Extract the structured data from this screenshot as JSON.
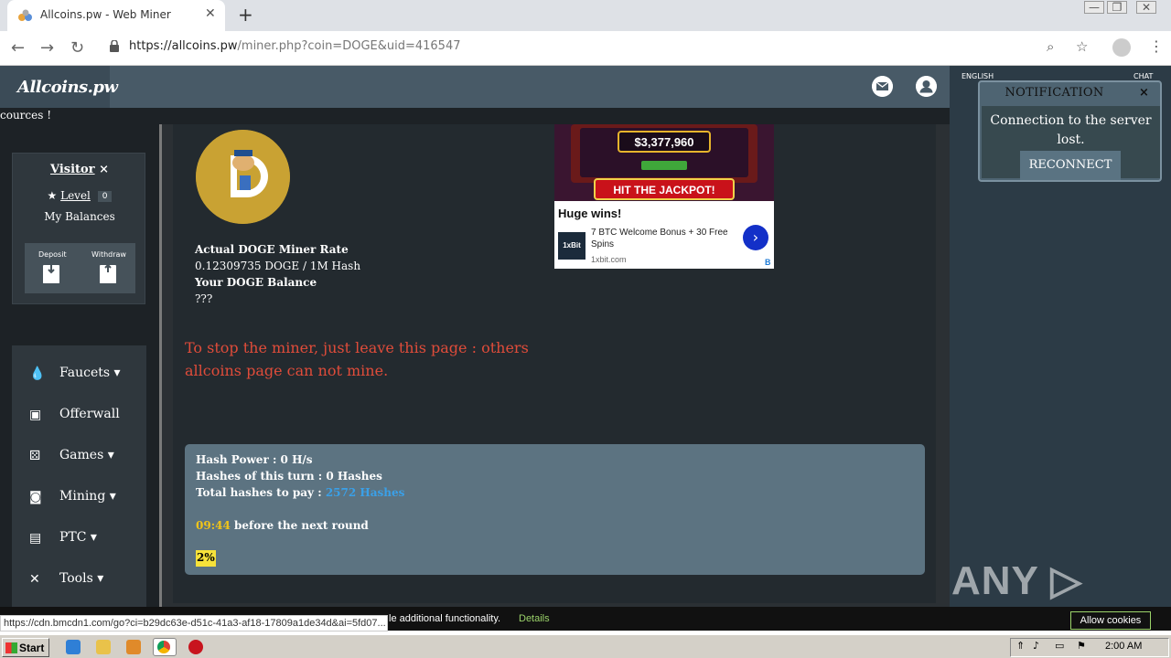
{
  "browser": {
    "tab_title": "Allcoins.pw - Web Miner",
    "tab_close": "✕",
    "new_tab": "+",
    "url_host": "https://allcoins.pw",
    "url_path": "/miner.php?coin=DOGE&uid=416547",
    "back": "←",
    "forward": "→",
    "reload": "↻",
    "zoom_icon": "⌕",
    "star_icon": "☆",
    "menu_icon": "⋮",
    "window_controls": [
      "—",
      "❐",
      "✕"
    ]
  },
  "site": {
    "logo": "Allcoins.pw",
    "ticker": "cources !"
  },
  "user": {
    "name": "Visitor",
    "close": "×",
    "level_label": "Level",
    "level_value": "0",
    "balances": "My Balances",
    "deposit": "Deposit",
    "withdraw": "Withdraw"
  },
  "menu": [
    {
      "label": "Faucets ▾",
      "icon": "drop-icon"
    },
    {
      "label": "Offerwall",
      "icon": "monitor-icon"
    },
    {
      "label": "Games ▾",
      "icon": "dice-icon"
    },
    {
      "label": "Mining ▾",
      "icon": "cash-icon"
    },
    {
      "label": "PTC ▾",
      "icon": "card-icon"
    },
    {
      "label": "Tools ▾",
      "icon": "tools-icon"
    }
  ],
  "miner": {
    "rate_title": "Actual DOGE Miner Rate",
    "rate_value": "0.12309735 DOGE / 1M Hash",
    "balance_title": "Your DOGE Balance",
    "balance_value": "???",
    "stop_message_1": "To stop the miner, just leave this page : others",
    "stop_message_2": "allcoins page can not mine.",
    "hash_power": "Hash Power : 0 H/s",
    "hashes_turn": "Hashes of this turn : 0 Hashes",
    "total_label": "Total hashes to pay : ",
    "total_value": "2572 Hashes",
    "timer": "09:44",
    "timer_suffix": " before the next round",
    "progress_label": "2%",
    "progress": 0.02
  },
  "ad": {
    "jackpot_amount": "$3,377,960",
    "jackpot_button": "HIT THE JACKPOT!",
    "headline": "Huge wins!",
    "text": "7 BTC Welcome Bonus + 30 Free Spins",
    "domain": "1xbit.com",
    "brand": "1xBit",
    "arrow": "›",
    "corner": "B"
  },
  "right_panel": {
    "language": "ENGLISH",
    "chat": "CHAT"
  },
  "notification": {
    "title": "NOTIFICATION",
    "close": "×",
    "message": "Connection to the server lost.",
    "button": "RECONNECT"
  },
  "cookie": {
    "text": "le additional functionality.",
    "details": "Details",
    "button": "Allow cookies"
  },
  "status_url": "https://cdn.bmcdn1.com/go?ci=b29dc63e-d51c-41a3-af18-17809a1de34d&ai=5fd07...",
  "watermark": "ANY ▷ RUN",
  "taskbar": {
    "start": "Start",
    "clock": "2:00 AM"
  }
}
